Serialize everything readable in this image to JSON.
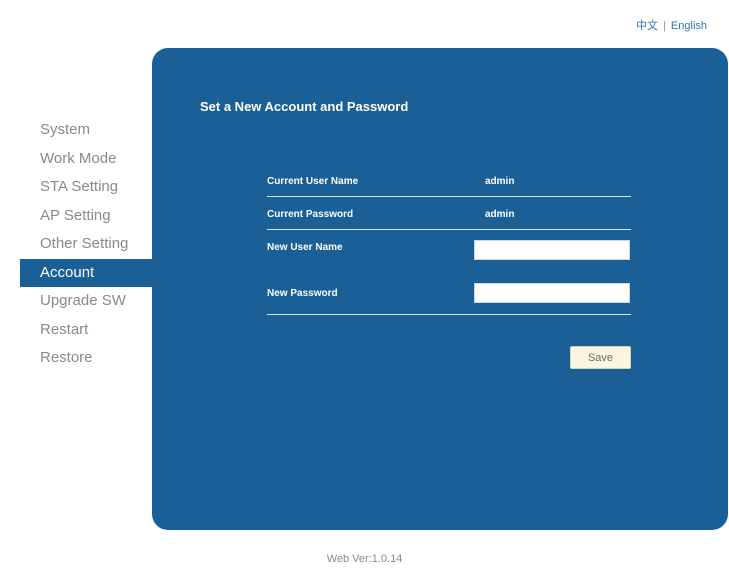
{
  "language": {
    "chinese": "中文",
    "separator": "|",
    "english": "English"
  },
  "sidebar": {
    "items": [
      {
        "label": "System"
      },
      {
        "label": "Work Mode"
      },
      {
        "label": "STA Setting"
      },
      {
        "label": "AP Setting"
      },
      {
        "label": "Other Setting"
      },
      {
        "label": "Account",
        "active": true
      },
      {
        "label": "Upgrade SW"
      },
      {
        "label": "Restart"
      },
      {
        "label": "Restore"
      }
    ]
  },
  "panel": {
    "title": "Set a New Account and Password",
    "current_user_label": "Current User Name",
    "current_user_value": "admin",
    "current_password_label": "Current Password",
    "current_password_value": "admin",
    "new_user_label": "New User Name",
    "new_user_value": "",
    "new_password_label": "New Password",
    "new_password_value": "",
    "save_label": "Save"
  },
  "footer": {
    "version": "Web Ver:1.0.14"
  },
  "colors": {
    "panel": "#1a5f96",
    "active_item": "#1a5f96",
    "sidebar_text": "#8a8a8a",
    "save_button_bg": "#fbf6df"
  }
}
